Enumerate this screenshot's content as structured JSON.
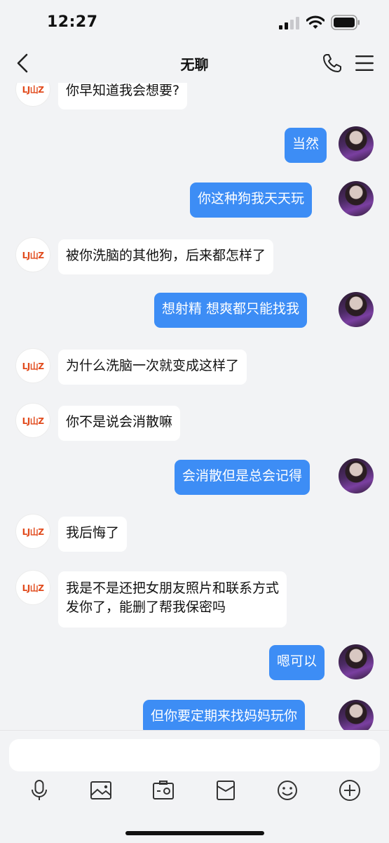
{
  "status_bar": {
    "time": "12:27"
  },
  "header": {
    "title": "无聊"
  },
  "messages": [
    {
      "side": "in",
      "text": "你早知道我会想要?"
    },
    {
      "side": "out",
      "text": "当然"
    },
    {
      "side": "out",
      "text": "你这种狗我天天玩"
    },
    {
      "side": "in",
      "text": "被你洗脑的其他狗，后来都怎样了"
    },
    {
      "side": "out",
      "text": "想射精 想爽都只能找我"
    },
    {
      "side": "in",
      "text": "为什么洗脑一次就变成这样了"
    },
    {
      "side": "in",
      "text": "你不是说会消散嘛"
    },
    {
      "side": "out",
      "text": "会消散但是总会记得"
    },
    {
      "side": "in",
      "text": "我后悔了"
    },
    {
      "side": "in",
      "text": "我是不是还把女朋友照片和联系方式",
      "text2": "发你了，能删了帮我保密吗"
    },
    {
      "side": "out",
      "text": "嗯可以"
    },
    {
      "side": "out",
      "text": "但你要定期来找妈妈玩你"
    }
  ],
  "contact_avatar_logo_text": "LJ山Z",
  "toolbar": {
    "icons": [
      "microphone-icon",
      "image-icon",
      "camera-icon",
      "wallet-icon",
      "emoji-icon",
      "plus-icon"
    ]
  }
}
